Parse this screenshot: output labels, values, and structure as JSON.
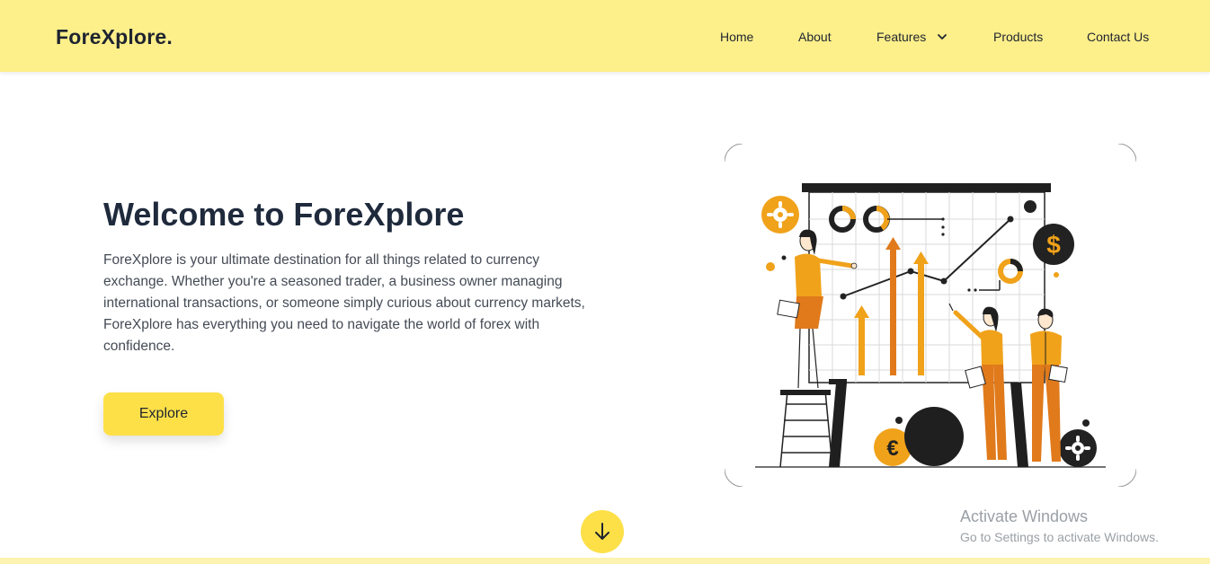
{
  "nav": {
    "brand": "ForeXplore.",
    "links": [
      {
        "label": "Home"
      },
      {
        "label": "About"
      },
      {
        "label": "Features",
        "has_dropdown": true
      },
      {
        "label": "Products"
      },
      {
        "label": "Contact Us"
      }
    ]
  },
  "hero": {
    "title": "Welcome to ForeXplore",
    "description": "ForeXplore is your ultimate destination for all things related to currency exchange. Whether you're a seasoned trader, a business owner managing international transactions, or someone simply curious about currency markets, ForeXplore has everything you need to navigate the world of forex with confidence.",
    "cta_label": "Explore",
    "illustration_icons": [
      "gear-icon",
      "dollar-icon",
      "euro-icon",
      "donut-chart-icon"
    ]
  },
  "scroll_down": {
    "icon": "arrow-down-icon"
  },
  "watermark": {
    "title": "Activate Windows",
    "subtitle": "Go to Settings to activate Windows."
  },
  "colors": {
    "nav_bg": "#fdef8a",
    "accent": "#fde048",
    "orange": "#f0a21a",
    "dark": "#1f2430"
  }
}
